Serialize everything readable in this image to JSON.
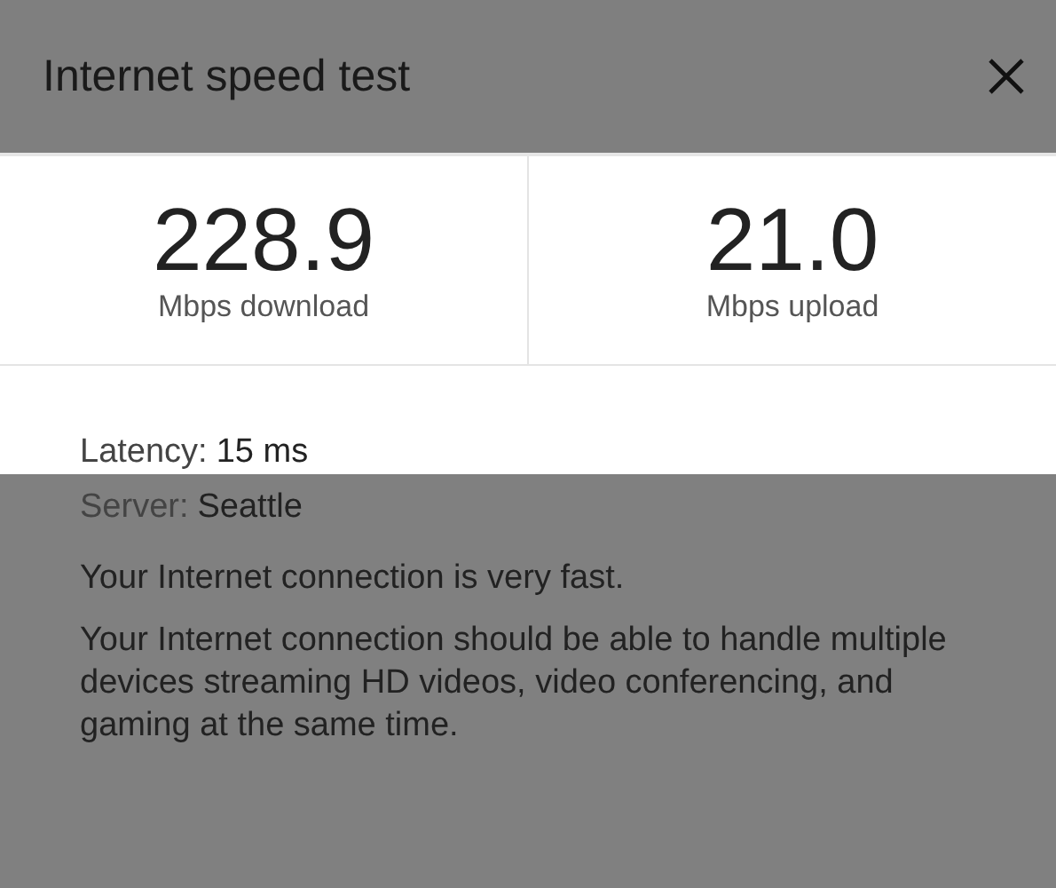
{
  "dialog": {
    "title": "Internet speed test"
  },
  "results": [
    {
      "value": "228.9",
      "unit": "Mbps download"
    },
    {
      "value": "21.0",
      "unit": "Mbps upload"
    }
  ],
  "details": [
    {
      "label": "Latency:",
      "value": "15 ms"
    },
    {
      "label": "Server:",
      "value": "Seattle"
    }
  ],
  "summary": {
    "heading": "Your Internet connection is very fast.",
    "text": "Your Internet connection should be able to handle multiple devices streaming HD videos, video conferencing, and gaming at the same time."
  }
}
